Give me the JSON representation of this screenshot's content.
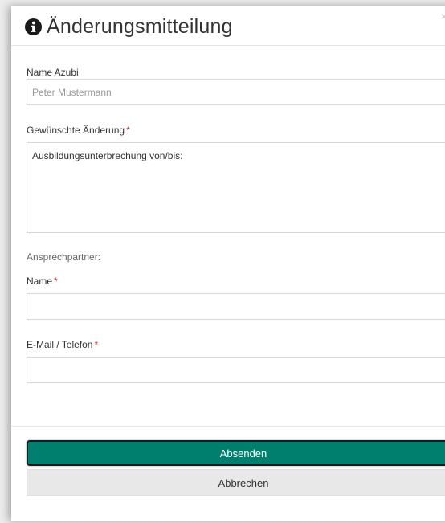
{
  "modal": {
    "title": "Änderungsmitteilung",
    "icon": "info-circle-icon",
    "close_glyph": "×"
  },
  "form": {
    "name_azubi": {
      "label": "Name Azubi",
      "placeholder": "Peter Mustermann",
      "value": ""
    },
    "change": {
      "label": "Gewünschte Änderung",
      "required_mark": "*",
      "value": "Ausbildungsunterbrechung von/bis:"
    },
    "contact_section_label": "Ansprechpartner:",
    "contact_name": {
      "label": "Name",
      "required_mark": "*",
      "value": ""
    },
    "contact_email_phone": {
      "label": "E-Mail / Telefon",
      "required_mark": "*",
      "value": ""
    }
  },
  "footer": {
    "submit_label": "Absenden",
    "cancel_label": "Abbrechen"
  },
  "colors": {
    "submit_bg": "#007f6e",
    "required": "#c9302c",
    "cancel_bg": "#e8e8e8"
  }
}
